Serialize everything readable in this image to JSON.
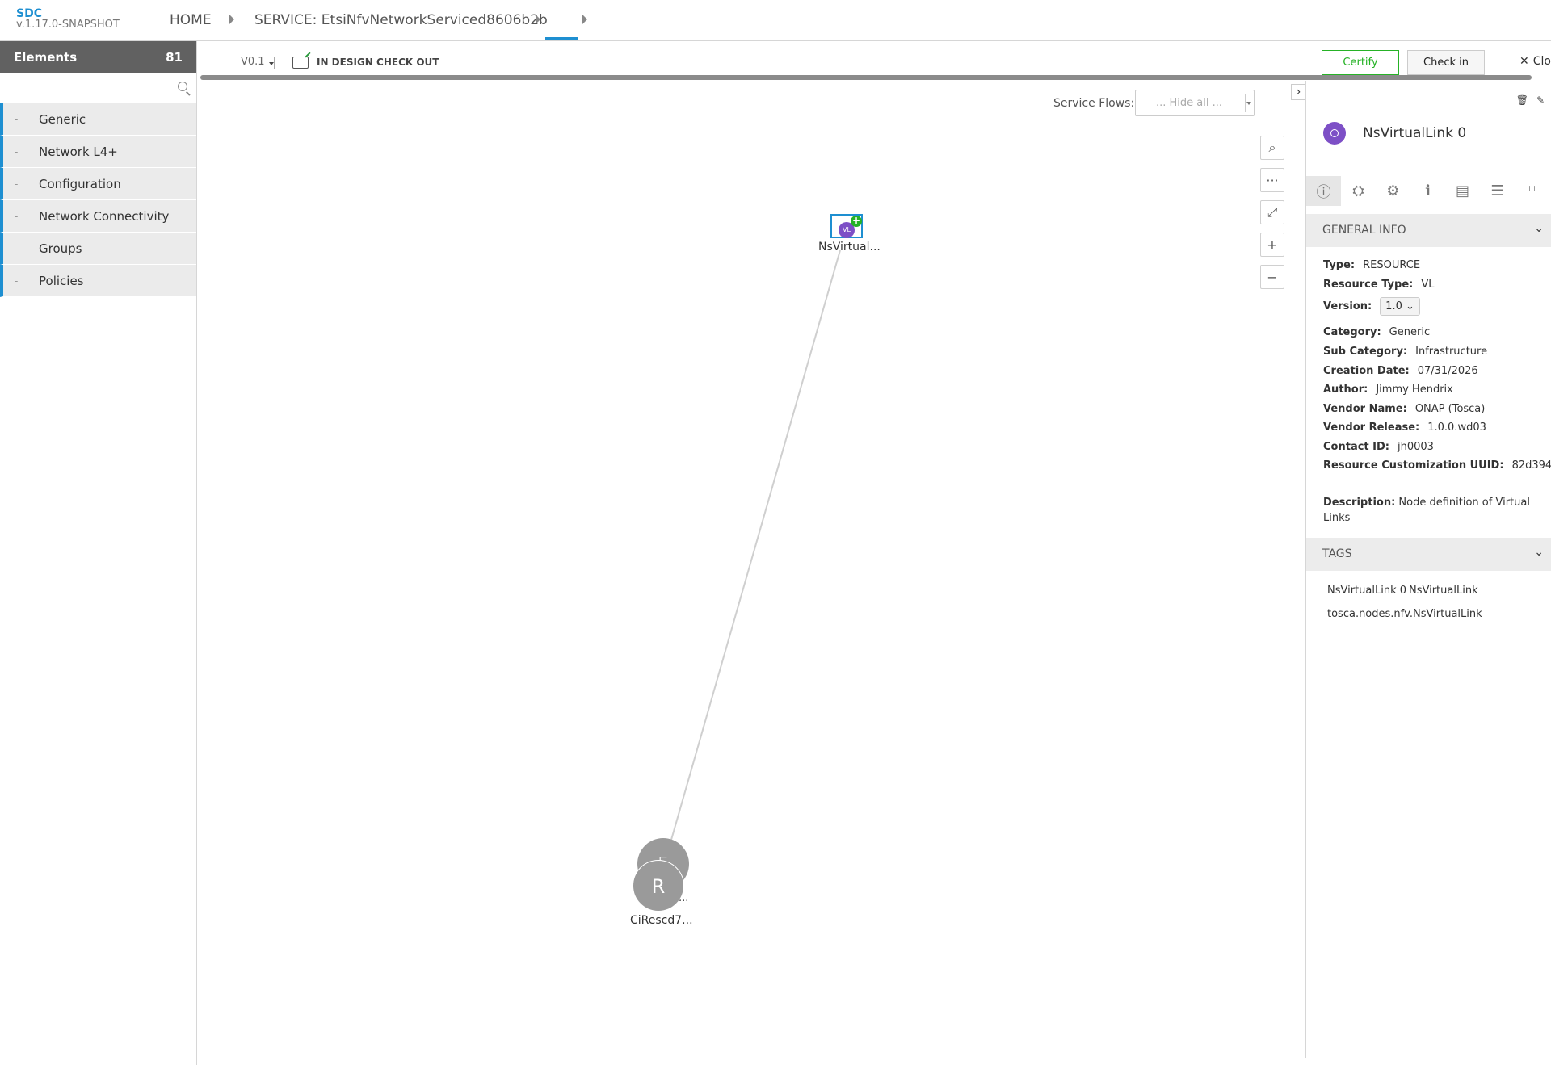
{
  "app": {
    "name": "SDC",
    "version": "v.1.17.0-SNAPSHOT"
  },
  "nav": {
    "home": "HOME",
    "service": "SERVICE: EtsiNfvNetworkServiced8606b2b"
  },
  "palette": {
    "title": "Elements",
    "count": "81",
    "search_placeholder": "",
    "groups": [
      "Generic",
      "Network L4+",
      "Configuration",
      "Network Connectivity",
      "Groups",
      "Policies"
    ]
  },
  "workbar": {
    "version": "V0.1",
    "status": "IN DESIGN CHECK OUT",
    "certify": "Certify",
    "checkin": "Check in",
    "close": "Clo"
  },
  "canvas": {
    "flows_label": "Service Flows:",
    "flows_value": "... Hide all ...",
    "nodes": [
      {
        "label": "NsVirtual...",
        "badge": "VL"
      },
      {
        "label": "CiRescd7...",
        "letter": "R",
        "back_label": "..."
      }
    ]
  },
  "panel": {
    "component_name": "NsVirtualLink 0",
    "general_info_title": "GENERAL INFO",
    "fields": {
      "type_k": "Type:",
      "type_v": "RESOURCE",
      "rtype_k": "Resource Type:",
      "rtype_v": "VL",
      "version_k": "Version:",
      "version_v": "1.0",
      "category_k": "Category:",
      "category_v": "Generic",
      "subcat_k": "Sub Category:",
      "subcat_v": "Infrastructure",
      "date_k": "Creation Date:",
      "date_v": "07/31/2026",
      "author_k": "Author:",
      "author_v": "Jimmy Hendrix",
      "vendor_k": "Vendor Name:",
      "vendor_v": "ONAP (Tosca)",
      "vrel_k": "Vendor Release:",
      "vrel_v": "1.0.0.wd03",
      "contact_k": "Contact ID:",
      "contact_v": "jh0003",
      "uuid_k": "Resource Customization UUID:",
      "uuid_v": "82d394...",
      "desc_k": "Description:",
      "desc_v": "Node definition of Virtual Links"
    },
    "tags_title": "TAGS",
    "tags": [
      "NsVirtualLink 0",
      "NsVirtualLink",
      "tosca.nodes.nfv.NsVirtualLink"
    ]
  }
}
